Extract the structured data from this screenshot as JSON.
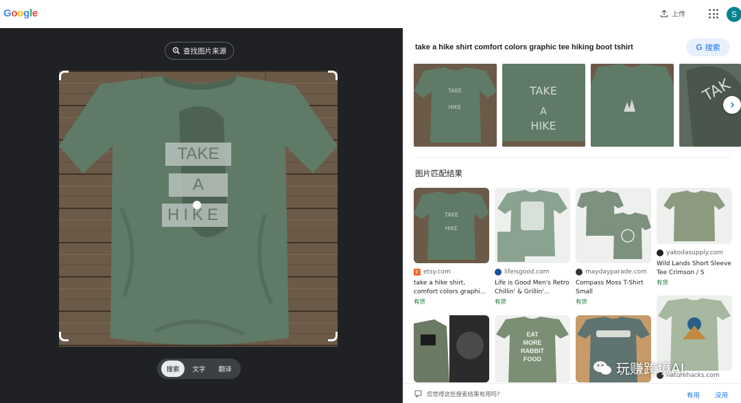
{
  "header": {
    "logo": [
      "G",
      "o",
      "o",
      "g",
      "l",
      "e"
    ],
    "logo_colors": [
      "#4285f4",
      "#ea4335",
      "#fbbc05",
      "#4285f4",
      "#34a853",
      "#ea4335"
    ],
    "upload_label": "上传",
    "avatar_letter": "S"
  },
  "left_panel": {
    "find_source_label": "查找图片来源",
    "shirt_text": [
      "TAKE",
      "A",
      "HIKE"
    ],
    "modes": [
      {
        "label": "搜索",
        "active": true
      },
      {
        "label": "文字",
        "active": false
      },
      {
        "label": "翻译",
        "active": false
      }
    ]
  },
  "right_panel": {
    "query": "take a hike shirt comfort colors graphic tee hiking boot tshirt",
    "search_button": "搜索",
    "section_title": "图片匹配结果",
    "results": [
      {
        "source": "etsy.com",
        "title": "take a hike shirt, comfort colors graphi...",
        "stock": "有货",
        "fav_color": "#f1641e",
        "fav": "E"
      },
      {
        "source": "lifeisgood.com",
        "title": "Life is Good Men's Retro Chillin' & Grillin'...",
        "stock": "有货",
        "fav_color": "#1a4fa0",
        "fav": ""
      },
      {
        "source": "maydayparade.com",
        "title": "Compass Moss T-Shirt Small",
        "stock": "有货",
        "fav_color": "#333333",
        "fav": ""
      },
      {
        "source": "yakodasupply.com",
        "title": "Wild Lands Short Sleeve Tee Crimson / S",
        "stock": "有货",
        "fav_color": "#222222",
        "fav": ""
      }
    ],
    "row2_texts": [
      "EAT",
      "MORE",
      "RABBIT",
      "FOOD"
    ],
    "row2_source": "naturehacks.com",
    "feedback_question": "您觉得这些搜索结果有用吗?",
    "yes_label": "有用",
    "no_label": "没用"
  },
  "watermark": "玩赚跨境AI",
  "colors": {
    "shirt": "#5f7a66",
    "shirt_dark": "#4c6553",
    "wood": "#6b5a48",
    "accent": "#1a73e8"
  }
}
